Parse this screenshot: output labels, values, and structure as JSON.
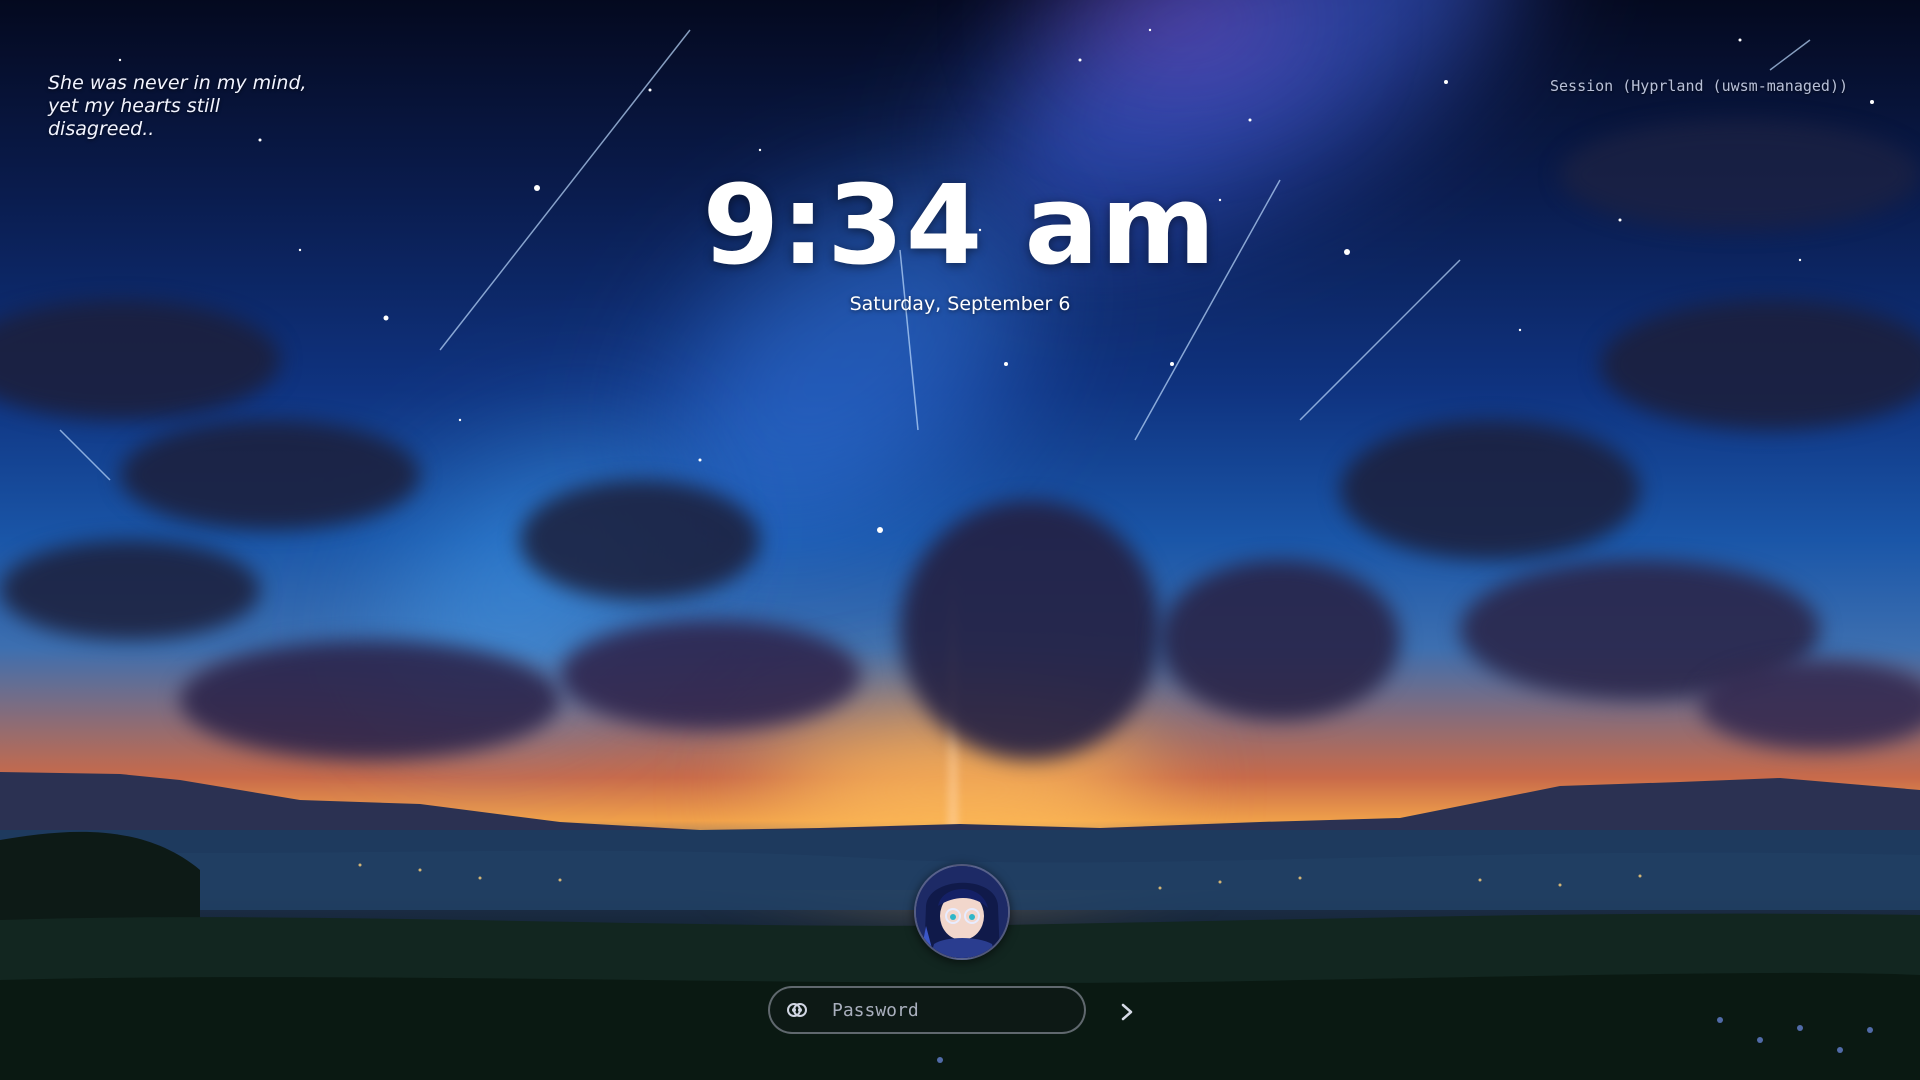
{
  "lockscreen": {
    "quote": "She was never in my mind, yet my hearts still disagreed..",
    "session": "Session (Hyprland (uwsm-managed))",
    "clock": "9:34 am",
    "date": "Saturday, September 6",
    "password_placeholder": "Password",
    "icons": {
      "password_visibility": "eye-toggle-icon",
      "submit": "chevron-right-icon",
      "avatar": "user-avatar"
    },
    "colors": {
      "text": "#ffffff",
      "muted": "#b8c0d8",
      "input_border": "#c8cddc"
    }
  }
}
